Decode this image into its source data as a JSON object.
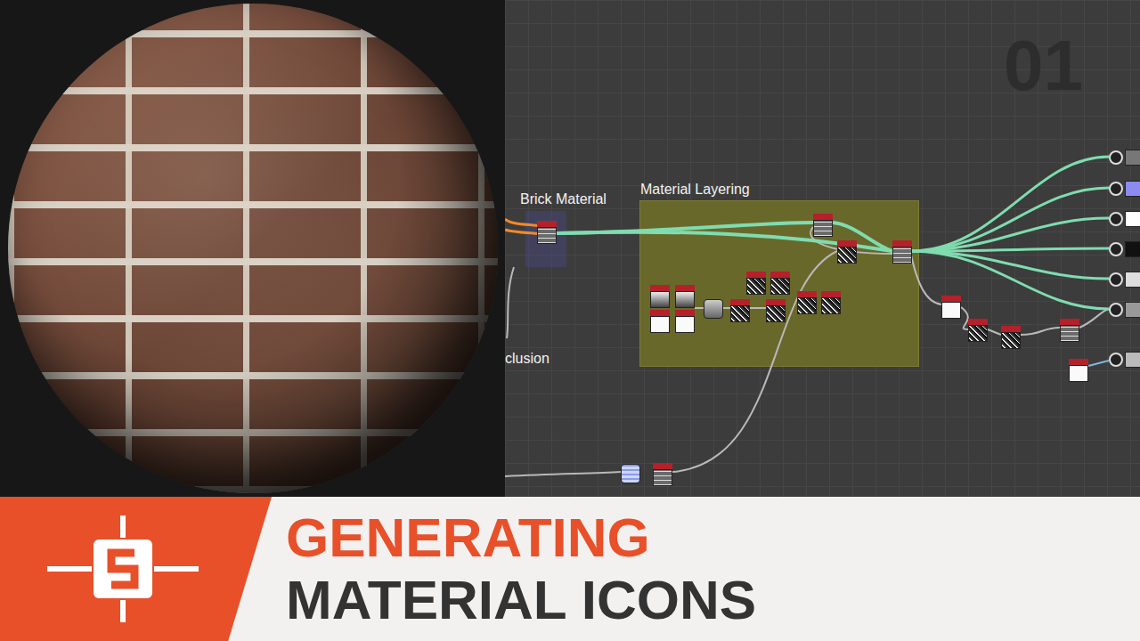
{
  "graph": {
    "episode": "01",
    "frames": [
      {
        "title": "Brick Material",
        "kind": "small"
      },
      {
        "title": "Material Layering",
        "kind": "large"
      }
    ],
    "cut_label": "clusion"
  },
  "title": {
    "lines": [
      {
        "text": "GENERATING",
        "color": "#e8502a"
      },
      {
        "text": "MATERIAL ICONS",
        "color": "#333333"
      }
    ]
  }
}
